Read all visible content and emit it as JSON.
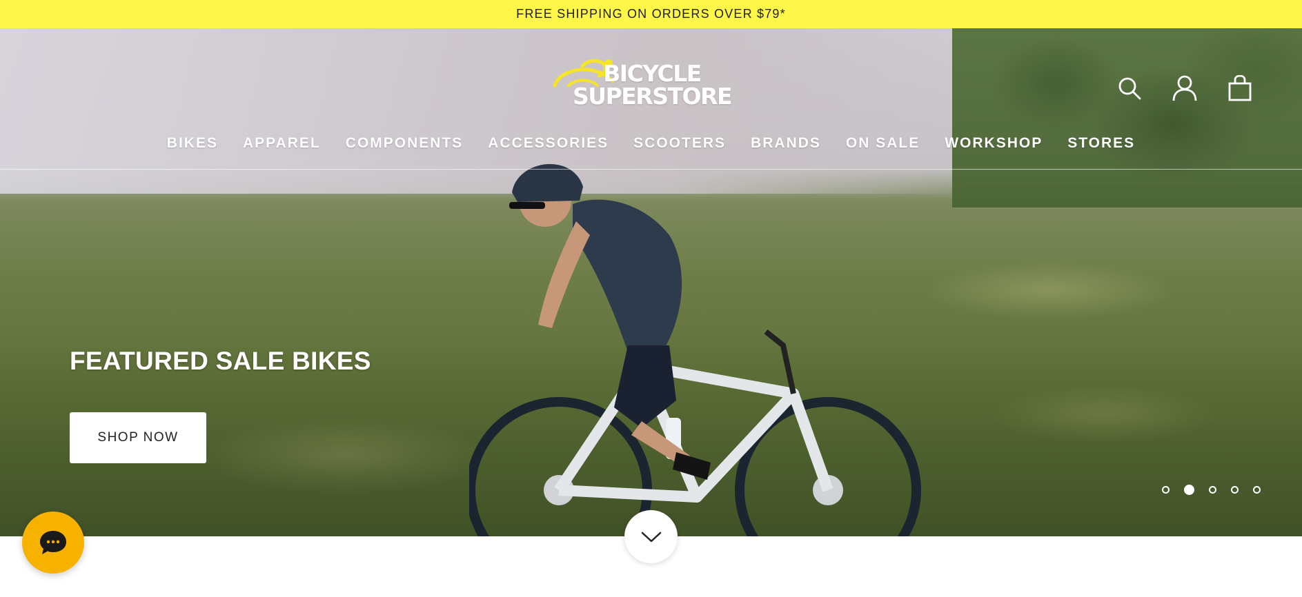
{
  "announcement": {
    "text": "FREE SHIPPING ON ORDERS OVER $79*"
  },
  "header": {
    "logo_text": "BICYCLE SUPERSTORE",
    "icons": [
      "search-icon",
      "account-icon",
      "cart-icon"
    ]
  },
  "nav": {
    "items": [
      {
        "label": "BIKES"
      },
      {
        "label": "APPAREL"
      },
      {
        "label": "COMPONENTS"
      },
      {
        "label": "ACCESSORIES"
      },
      {
        "label": "SCOOTERS"
      },
      {
        "label": "BRANDS"
      },
      {
        "label": "ON SALE"
      },
      {
        "label": "WORKSHOP"
      },
      {
        "label": "STORES"
      }
    ]
  },
  "hero": {
    "title": "FEATURED SALE BIKES",
    "cta_label": "SHOP NOW",
    "slides_total": 5,
    "active_slide": 2
  },
  "widgets": {
    "scroll_icon": "chevron-down-icon",
    "chat_icon": "chat-bubble-icon"
  },
  "colors": {
    "announcement_bg": "#fff64a",
    "logo_accent": "#f5e428",
    "chat_bg": "#f7b200",
    "text_light": "#ffffff"
  }
}
